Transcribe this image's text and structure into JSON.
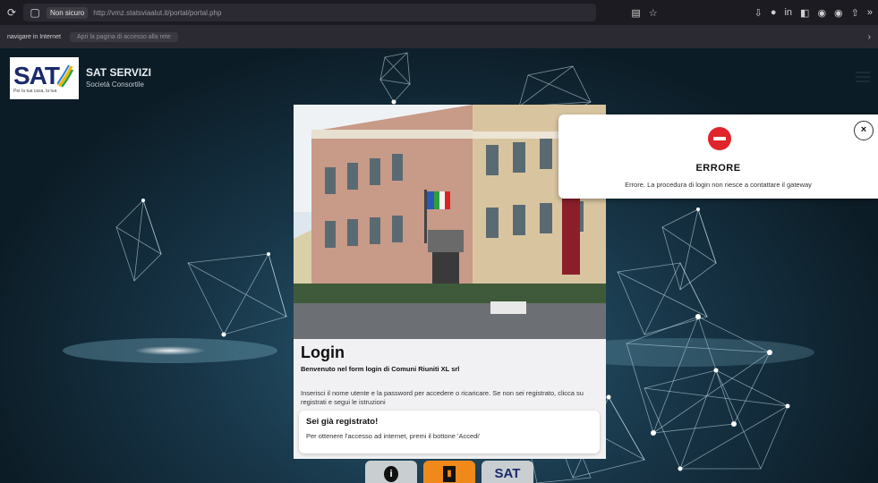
{
  "browser": {
    "security_label": "Non sicuro",
    "url": "http://vmz.statsviaalut.it/portal/portal.php",
    "bookmark_nav": "navigare in Internet",
    "bookmark_notice": "Apri la pagina di accesso alla rete"
  },
  "site": {
    "logo": "SAT",
    "logo_tagline": "Per la tua casa, la tua",
    "brand_name": "SAT SERVIZI",
    "brand_sub": "Società Consortile"
  },
  "login": {
    "title": "Login",
    "welcome": "Benvenuto nel form login di Comuni Riuniti XL srl",
    "description": "Inserisci il nome utente e la password per accedere o ricaricare. Se non sei registrato, clicca su registrati e segui le istruzioni",
    "registered_title": "Sei già registrato!",
    "registered_text": "Per ottenere l'accesso ad internet, premi il bottone 'Accedi'"
  },
  "bottom_buttons": {
    "info_glyph": "i",
    "door_glyph": "▮",
    "sat_glyph": "SAT"
  },
  "error": {
    "title": "ERRORE",
    "message": "Errore. La procedura di login non riesce a contattare il gateway",
    "close_glyph": "×"
  },
  "colors": {
    "error_red": "#e0242b",
    "accent_orange": "#ef8a1a",
    "logo_blue": "#1a2a6b"
  }
}
